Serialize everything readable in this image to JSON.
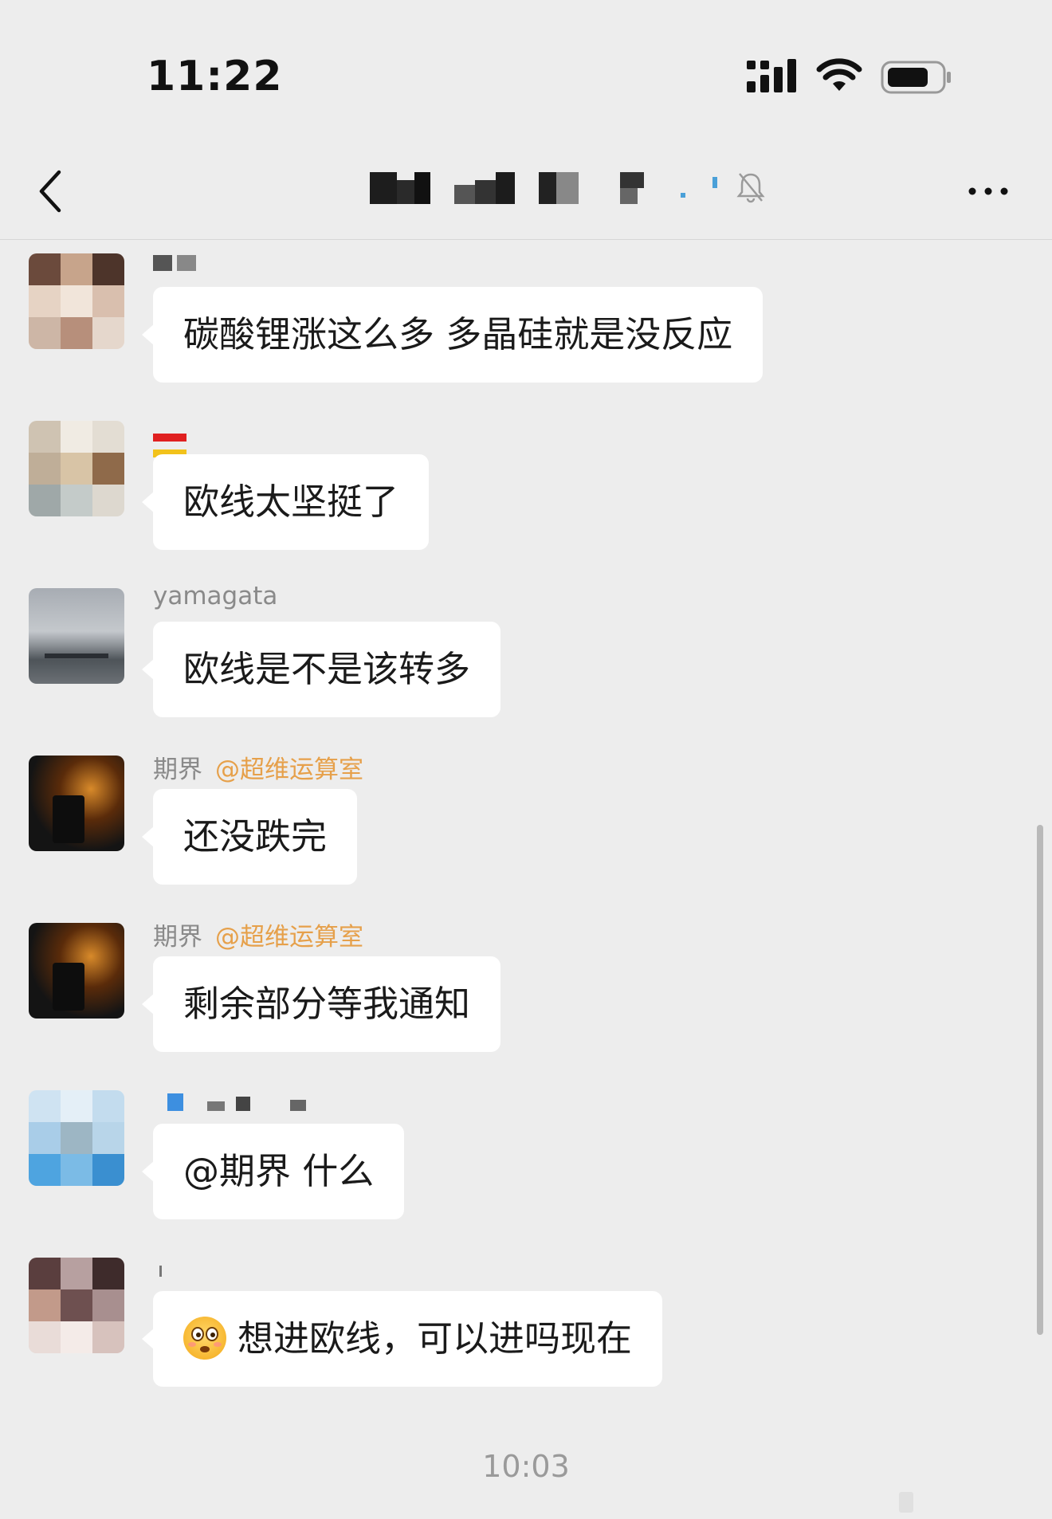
{
  "status_bar": {
    "time": "11:22"
  },
  "nav": {
    "title_masked": true
  },
  "messages": [
    {
      "sender": "",
      "mention": "",
      "text": "碳酸锂涨这么多 多晶硅就是没反应",
      "avatar": "pixelated-avatar"
    },
    {
      "sender": "",
      "mention": "",
      "text": "欧线太坚挺了",
      "avatar": "pixelated-avatar"
    },
    {
      "sender": "yamagata",
      "mention": "",
      "text": "欧线是不是该转多",
      "avatar": "cloudy-harbor-photo"
    },
    {
      "sender": "期界",
      "mention": "@超维运算室",
      "text": "还没跌完",
      "avatar": "fire-card-avatar"
    },
    {
      "sender": "期界",
      "mention": "@超维运算室",
      "text": "剩余部分等我通知",
      "avatar": "fire-card-avatar"
    },
    {
      "sender": "",
      "mention": "",
      "text": "@期界 什么",
      "avatar": "pixelated-avatar"
    },
    {
      "sender": "",
      "mention": "",
      "text": "想进欧线，可以进吗现在",
      "avatar": "pixelated-avatar",
      "emoji": "flushed-face-emoji"
    }
  ],
  "timestamp": "10:03",
  "colors": {
    "background": "#ededed",
    "bubble": "#ffffff",
    "mention": "#e6a04a",
    "sender": "#8a8a8a"
  }
}
